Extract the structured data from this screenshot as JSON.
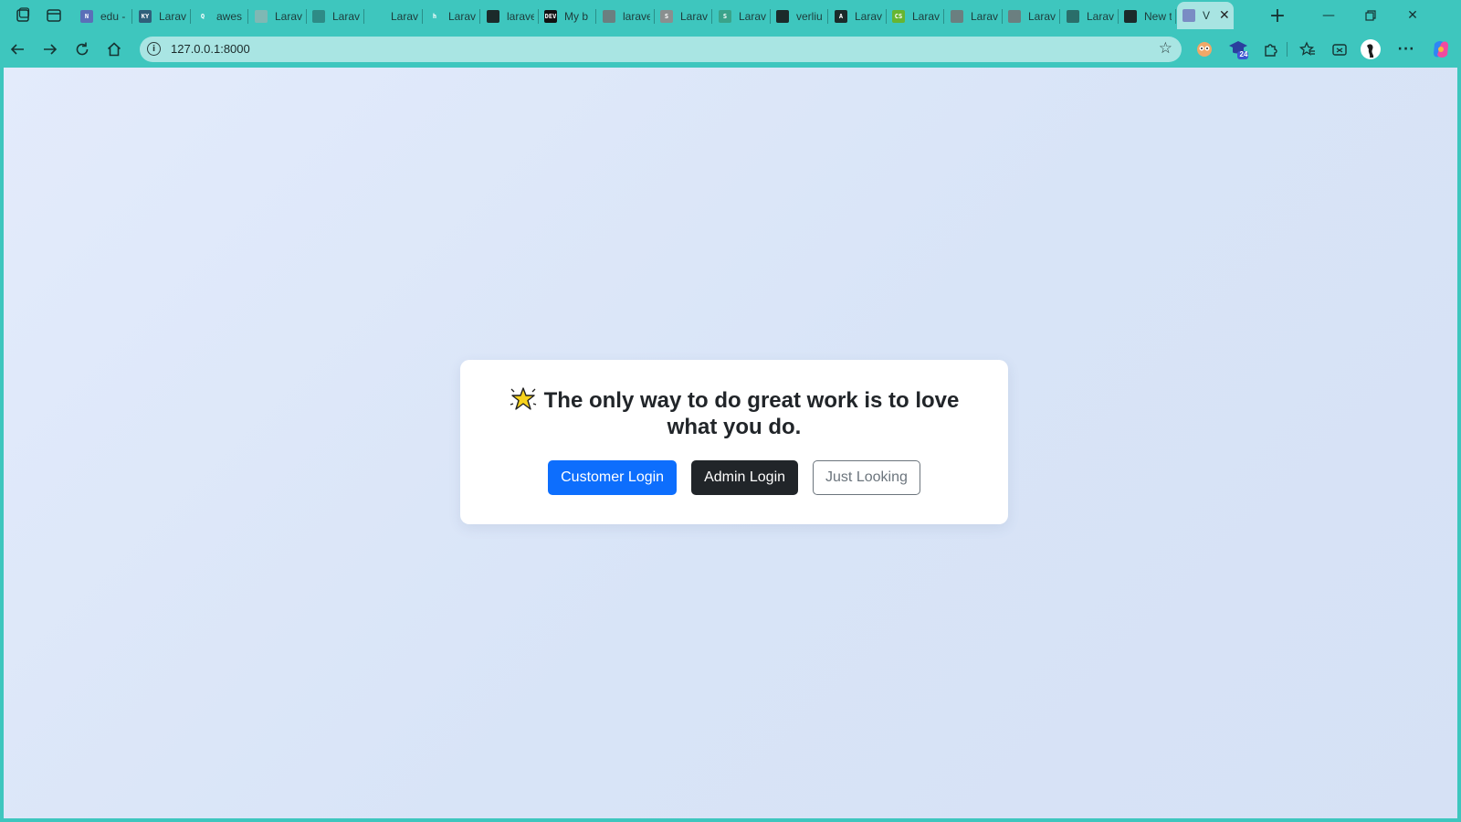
{
  "browser": {
    "tabs": [
      {
        "label": "edu -",
        "favicon_text": "N",
        "favicon_color": "#5b6fb8"
      },
      {
        "label": "Larav",
        "favicon_text": "KY",
        "favicon_color": "#2f5f7a"
      },
      {
        "label": "awes",
        "favicon_text": "Q",
        "favicon_color": "#3ec6be"
      },
      {
        "label": "Larav",
        "favicon_text": "",
        "favicon_color": "#7fb8b4"
      },
      {
        "label": "Larav",
        "favicon_text": "",
        "favicon_color": "#2e8b86"
      },
      {
        "label": "Larav",
        "favicon_text": "",
        "favicon_color": "#3ec6be"
      },
      {
        "label": "Larav",
        "favicon_text": "h",
        "favicon_color": "#3ec6be"
      },
      {
        "label": "larave",
        "favicon_text": "",
        "favicon_color": "#1b2a2a"
      },
      {
        "label": "My b",
        "favicon_text": "DEV",
        "favicon_color": "#111111"
      },
      {
        "label": "larave",
        "favicon_text": "",
        "favicon_color": "#6b7f80"
      },
      {
        "label": "Larav",
        "favicon_text": "S",
        "favicon_color": "#8a8f8f"
      },
      {
        "label": "Larav",
        "favicon_text": "S",
        "favicon_color": "#3aa38a"
      },
      {
        "label": "verliu",
        "favicon_text": "",
        "favicon_color": "#1b2a2a"
      },
      {
        "label": "Larav",
        "favicon_text": "A",
        "favicon_color": "#1b2a2a"
      },
      {
        "label": "Larav",
        "favicon_text": "CS",
        "favicon_color": "#67b531"
      },
      {
        "label": "Larav",
        "favicon_text": "",
        "favicon_color": "#6b7f80"
      },
      {
        "label": "Larav",
        "favicon_text": "",
        "favicon_color": "#6b7f80"
      },
      {
        "label": "Larav",
        "favicon_text": "",
        "favicon_color": "#2a6e6a"
      },
      {
        "label": "New t",
        "favicon_text": "",
        "favicon_color": "#1b2a2a"
      },
      {
        "label": "V",
        "favicon_text": "",
        "favicon_color": "#7a8cc4"
      }
    ],
    "address_bar": {
      "url": "127.0.0.1:8000"
    },
    "extension_badge": "24"
  },
  "page": {
    "quote_emoji": "🌟",
    "quote": "The only way to do great work is to love what you do.",
    "buttons": {
      "customer": "Customer Login",
      "admin": "Admin Login",
      "looking": "Just Looking"
    }
  },
  "colors": {
    "browser_accent": "#3ec6be",
    "btn_primary": "#0d6efd",
    "btn_dark": "#212529",
    "btn_outline": "#6c757d"
  }
}
